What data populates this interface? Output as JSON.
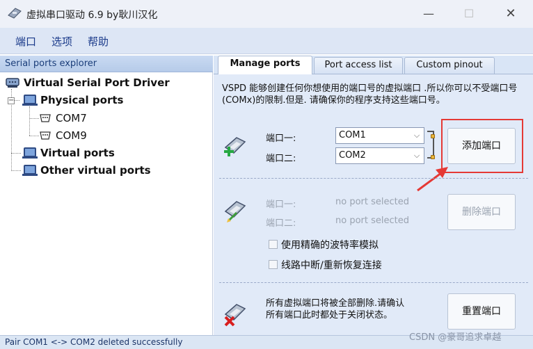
{
  "window": {
    "title": "虚拟串口驱动 6.9 by耿川汉化",
    "minimize_glyph": "—",
    "maximize_glyph": "☐",
    "close_glyph": "✕"
  },
  "menu": {
    "items": [
      {
        "label": "端口"
      },
      {
        "label": "选项"
      },
      {
        "label": "帮助"
      }
    ]
  },
  "explorer": {
    "header": "Serial ports explorer",
    "tree": {
      "root": "Virtual Serial Port Driver",
      "physical": "Physical ports",
      "physical_children": [
        "COM7",
        "COM9"
      ],
      "virtual": "Virtual ports",
      "other_virtual": "Other virtual ports"
    }
  },
  "tabs": [
    {
      "label": "Manage ports",
      "active": true
    },
    {
      "label": "Port access list",
      "active": false
    },
    {
      "label": "Custom pinout",
      "active": false
    }
  ],
  "manage": {
    "description": "VSPD 能够创建任何你想使用的端口号的虚拟端口 .所以你可以不受端口号(COMx)的限制.但是. 请确保你的程序支持这些端口号。",
    "add_section": {
      "port1_label": "端口一:",
      "port2_label": "端口二:",
      "port1_value": "COM1",
      "port2_value": "COM2",
      "add_button": "添加端口"
    },
    "delete_section": {
      "port1_label": "端口一:",
      "port2_label": "端口二:",
      "port1_value": "no port selected",
      "port2_value": "no port selected",
      "delete_button": "删除端口",
      "checkbox_baud": "使用精确的波特率模拟",
      "checkbox_reconnect": "线路中断/重新恢复连接"
    },
    "reset_section": {
      "text": "所有虚拟端口将被全部删除.请确认所有端口此时都处于关闭状态。",
      "reset_button": "重置端口"
    }
  },
  "status": {
    "message": "Pair COM1 <-> COM2 deleted successfully"
  },
  "watermark": "CSDN @豪哥追求卓越",
  "colors": {
    "accent_highlight": "#e53935",
    "menu_text": "#1a3a8a",
    "panel_bg": "#e1eaf8"
  },
  "icons": {
    "app": "serial-plug-icon",
    "add": "add-port-icon",
    "delete": "delete-port-icon",
    "reset": "reset-ports-icon",
    "computer": "computer-icon",
    "port": "serial-port-icon"
  }
}
